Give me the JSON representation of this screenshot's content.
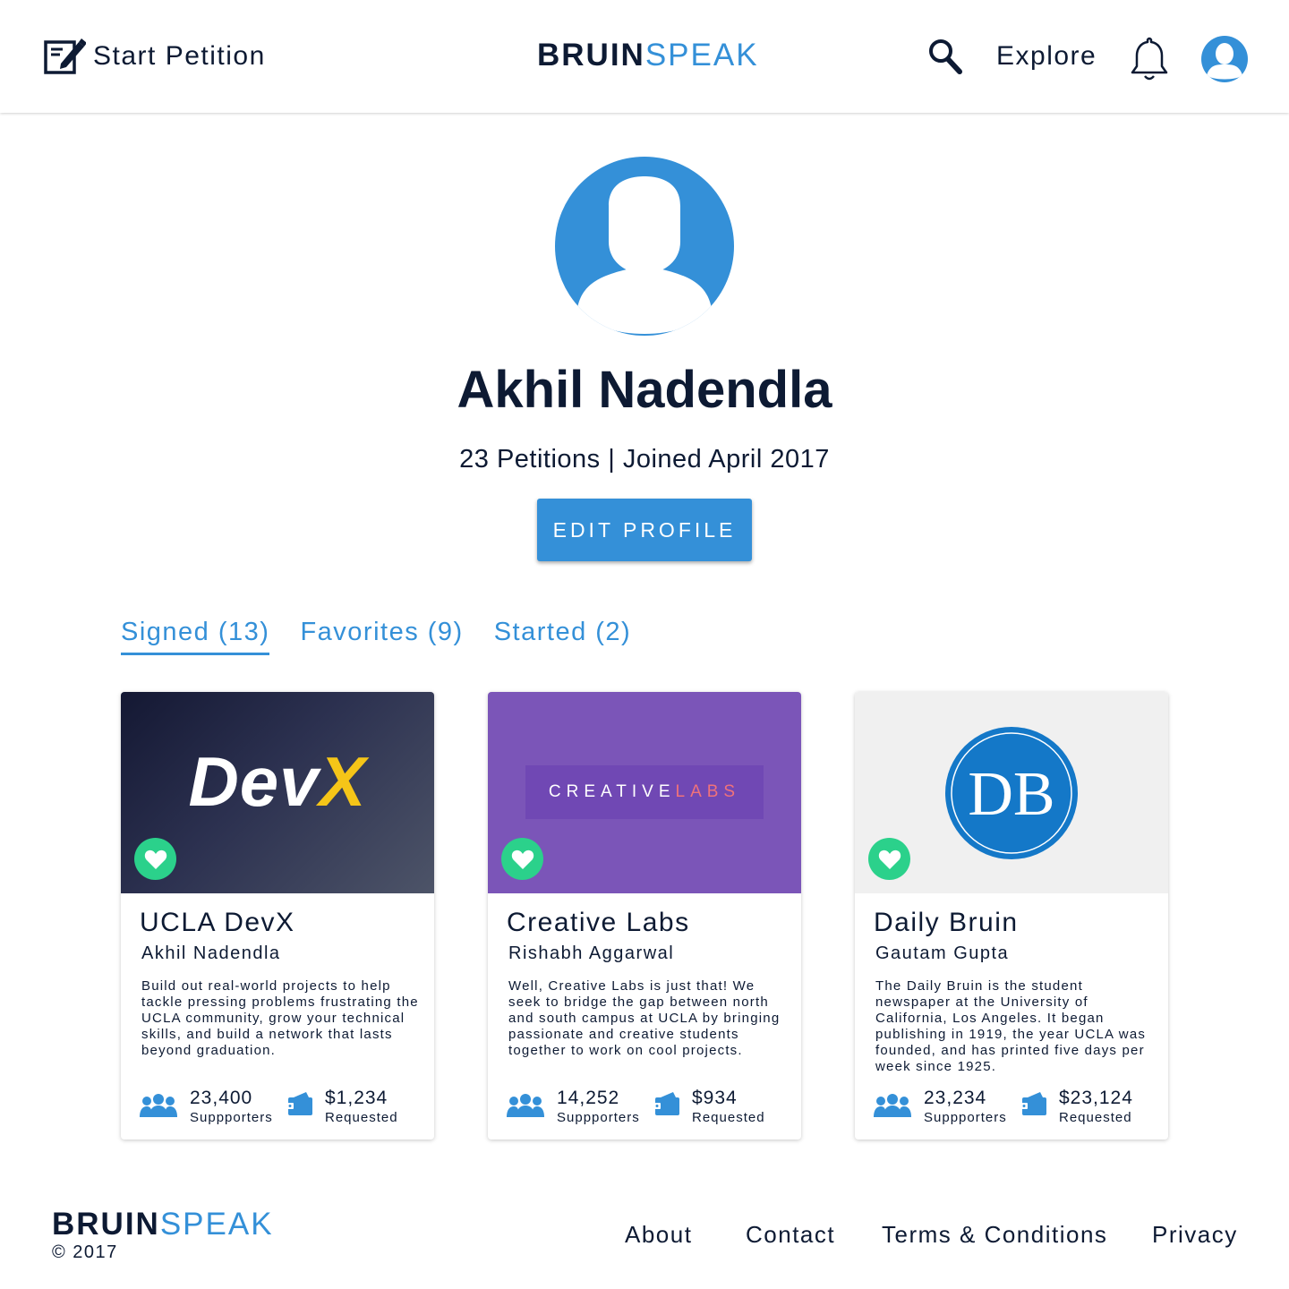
{
  "header": {
    "start_petition_label": "Start Petition",
    "logo_primary": "BRUIN",
    "logo_accent": "SPEAK",
    "explore_label": "Explore"
  },
  "profile": {
    "name": "Akhil Nadendla",
    "meta": "23 Petitions | Joined April 2017",
    "edit_label": "EDIT PROFILE"
  },
  "tabs": [
    {
      "label": "Signed (13)",
      "active": true
    },
    {
      "label": "Favorites (9)",
      "active": false
    },
    {
      "label": "Started (2)",
      "active": false
    }
  ],
  "cards": [
    {
      "image_text": "DevX",
      "title": "UCLA DevX",
      "author": "Akhil Nadendla",
      "description": "Build out real-world projects to help tackle pressing problems frustrating the UCLA community, grow your technical skills, and build a network that lasts beyond graduation.",
      "supporters": "23,400",
      "supporters_label": "Suppporters",
      "requested": "$1,234",
      "requested_label": "Requested"
    },
    {
      "image_text": "CREATIVELABS",
      "title": "Creative Labs",
      "author": "Rishabh Aggarwal",
      "description": "Well, Creative Labs is just that! We seek to bridge the gap between north and south campus at UCLA by bringing passionate and creative students together to work on cool projects.",
      "supporters": "14,252",
      "supporters_label": "Suppporters",
      "requested": "$934",
      "requested_label": "Requested"
    },
    {
      "image_text": "DB",
      "title": "Daily Bruin",
      "author": "Gautam Gupta",
      "description": "The Daily Bruin is the student newspaper at the University of California, Los Angeles. It began publishing in 1919, the year UCLA was founded, and has printed five days per week since 1925.",
      "supporters": "23,234",
      "supporters_label": "Suppporters",
      "requested": "$23,124",
      "requested_label": "Requested"
    }
  ],
  "footer": {
    "logo_primary": "BRUIN",
    "logo_accent": "SPEAK",
    "copyright": "© 2017",
    "links": [
      "About",
      "Contact",
      "Terms & Conditions",
      "Privacy"
    ]
  },
  "colors": {
    "accent": "#3490d8",
    "text": "#0d1a33",
    "favorite": "#2bd18b",
    "devx_bg": "#2a3048",
    "creative_bg": "#7b55b8",
    "dailybruin_bg": "#f0f0f0"
  },
  "icons": [
    "compose-icon",
    "search-icon",
    "bell-icon",
    "user-avatar-icon",
    "heart-icon",
    "group-icon",
    "wallet-icon"
  ]
}
